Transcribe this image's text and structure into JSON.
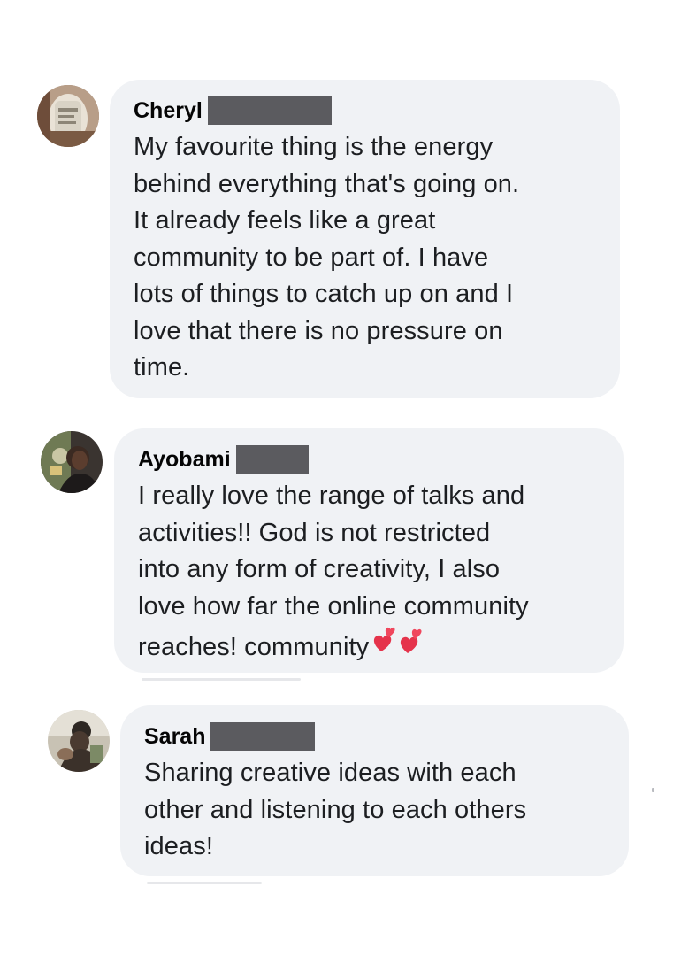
{
  "comments": [
    {
      "author": "Cheryl",
      "text_lines": [
        "My favourite thing is the energy",
        "behind everything that's going on.",
        "It already feels like a great",
        "community to be part of. I have",
        "lots of things to catch up on and I",
        "love that there is no pressure on",
        "time."
      ]
    },
    {
      "author": "Ayobami",
      "text_lines": [
        "I really love the range of talks and",
        "activities!! God is not restricted",
        "into any form of creativity, I also",
        "love how far the online community",
        "reaches! community"
      ],
      "emoji_icon": "revolving-hearts-icon"
    },
    {
      "author": "Sarah",
      "text_lines": [
        "Sharing creative ideas with each",
        "other and listening to each others",
        "ideas!"
      ]
    }
  ],
  "colors": {
    "bubble": "#f0f2f5",
    "redaction": "#5b5b5f",
    "text": "#1c1e21"
  }
}
